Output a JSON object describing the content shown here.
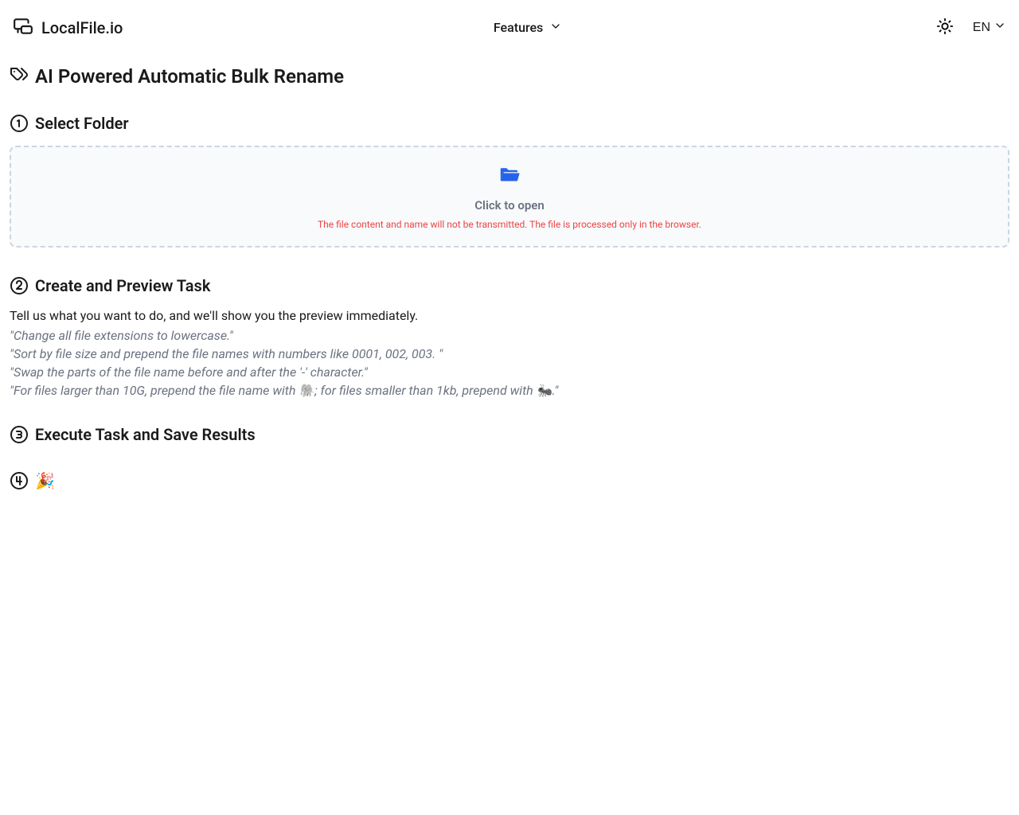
{
  "header": {
    "brand": "LocalFile.io",
    "features_label": "Features",
    "language": "EN"
  },
  "page": {
    "title": "AI Powered Automatic Bulk Rename"
  },
  "step1": {
    "title": "Select Folder",
    "dropzone_main": "Click to open",
    "dropzone_sub": "The file content and name will not be transmitted. The file is processed only in the browser."
  },
  "step2": {
    "title": "Create and Preview Task",
    "description": "Tell us what you want to do, and we'll show you the preview immediately.",
    "examples": [
      "\"Change all file extensions to lowercase.\"",
      "\"Sort by file size and prepend the file names with numbers like 0001, 002, 003. \"",
      "\"Swap the parts of the file name before and after the '-' character.\"",
      "\"For files larger than 10G, prepend the file name with 🐘; for files smaller than 1kb, prepend with 🐜.\""
    ]
  },
  "step3": {
    "title": "Execute Task and Save Results"
  },
  "step4": {
    "title": "🎉"
  }
}
